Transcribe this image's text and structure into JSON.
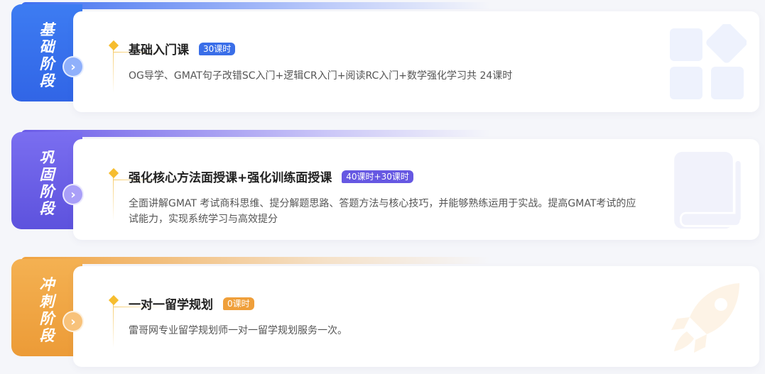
{
  "stages": [
    {
      "label": "基础阶段",
      "title": "基础入门课",
      "badge": "30课时",
      "description": "OG导学、GMAT句子改错SC入门+逻辑CR入门+阅读RC入门+数学强化学习共 24课时",
      "icon": "grid-icon",
      "accent": "#3a6ee8"
    },
    {
      "label": "巩固阶段",
      "title": "强化核心方法面授课+强化训练面授课",
      "badge": "40课时+30课时",
      "description": "全面讲解GMAT 考试商科思维、提分解题思路、答题方法与核心技巧，并能够熟练运用于实战。提高GMAT考试的应试能力，实现系统学习与高效提分",
      "icon": "book-icon",
      "accent": "#6658e2"
    },
    {
      "label": "冲刺阶段",
      "title": "一对一留学规划",
      "badge": "0课时",
      "description": "雷哥网专业留学规划师一对一留学规划服务一次。",
      "icon": "rocket-icon",
      "accent": "#ef9f3a"
    }
  ],
  "arrow_glyph": "›"
}
